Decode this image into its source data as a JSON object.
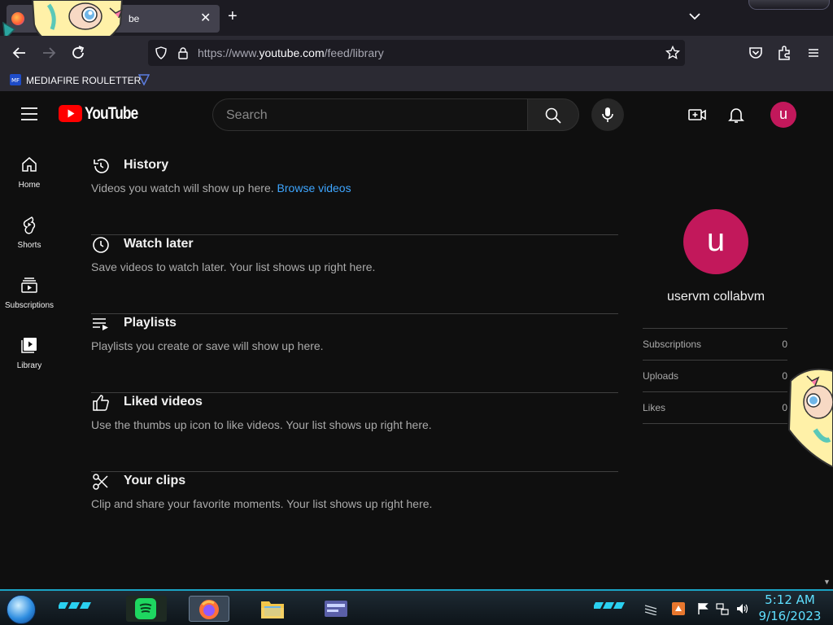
{
  "browser": {
    "tab_title": "be",
    "url_prefix": "https://www.",
    "url_domain": "youtube.com",
    "url_path": "/feed/library",
    "bookmarks": [
      {
        "label": "MEDIAFIRE ROULETTER",
        "icon": "mediafire-icon"
      },
      {
        "label": "",
        "icon": "bookmark-icon"
      }
    ]
  },
  "youtube": {
    "logo_text": "YouTube",
    "search_placeholder": "Search",
    "avatar_letter": "u",
    "guide": [
      {
        "label": "Home",
        "icon": "home-icon"
      },
      {
        "label": "Shorts",
        "icon": "shorts-icon"
      },
      {
        "label": "Subscriptions",
        "icon": "subscriptions-icon"
      },
      {
        "label": "Library",
        "icon": "library-icon"
      }
    ],
    "sections": [
      {
        "title": "History",
        "desc": "Videos you watch will show up here.",
        "link": "Browse videos",
        "icon": "history-icon"
      },
      {
        "title": "Watch later",
        "desc": "Save videos to watch later. Your list shows up right here.",
        "icon": "watch-later-icon"
      },
      {
        "title": "Playlists",
        "desc": "Playlists you create or save will show up here.",
        "icon": "playlists-icon"
      },
      {
        "title": "Liked videos",
        "desc": "Use the thumbs up icon to like videos. Your list shows up right here.",
        "icon": "thumbs-up-icon"
      },
      {
        "title": "Your clips",
        "desc": "Clip and share your favorite moments. Your list shows up right here.",
        "icon": "scissors-icon"
      }
    ],
    "profile": {
      "letter": "u",
      "name": "uservm collabvm",
      "stats": [
        {
          "label": "Subscriptions",
          "value": "0"
        },
        {
          "label": "Uploads",
          "value": "0"
        },
        {
          "label": "Likes",
          "value": "0"
        }
      ]
    }
  },
  "taskbar": {
    "time": "5:12 AM",
    "date": "9/16/2023",
    "apps": [
      "spotify-icon",
      "firefox-icon",
      "file-explorer-icon",
      "control-panel-icon"
    ]
  },
  "colors": {
    "accent_link": "#3ea6ff",
    "avatar_bg": "#c2185b",
    "youtube_red": "#ff0000",
    "clock": "#5fe0ff"
  }
}
